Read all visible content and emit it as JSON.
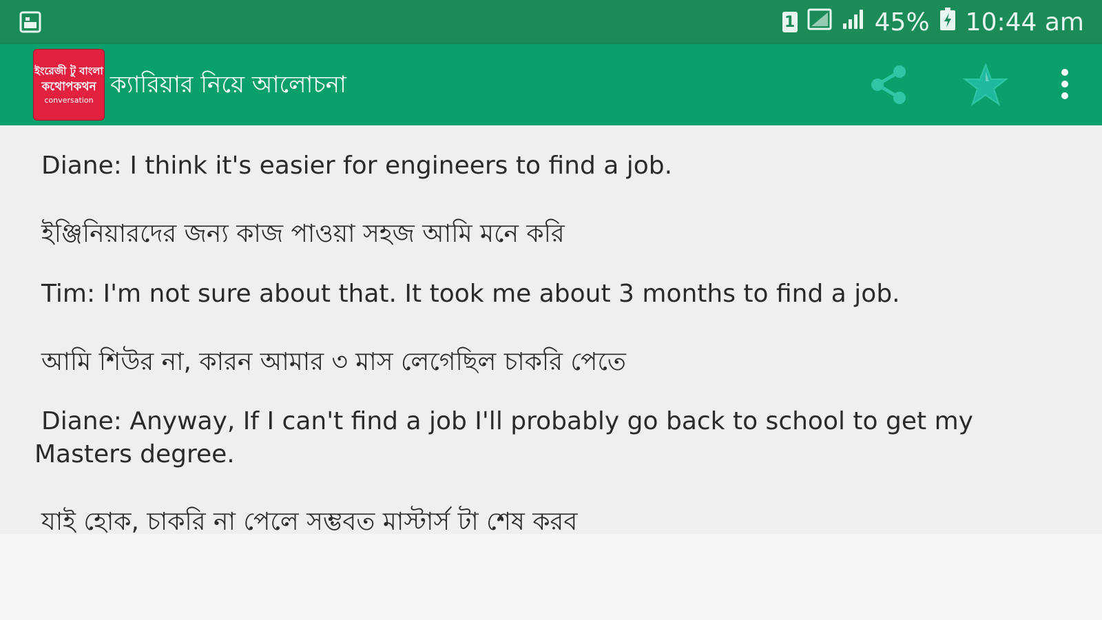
{
  "status_bar": {
    "sim_label": "1",
    "battery_percent": "45%",
    "time": "10:44 am",
    "colors": {
      "background": "#1b8b58",
      "foreground": "#e9f5ef"
    },
    "icons": [
      "image-icon",
      "sim-icon",
      "signal-box-icon",
      "signal-bars-icon",
      "battery-charging-icon"
    ]
  },
  "app_bar": {
    "title": "ক্যারিয়ার নিয়ে আলোচনা",
    "logo": {
      "line1": "ইংরেজী টু বাংলা",
      "line2": "কথোপকথন",
      "line3": "conversation",
      "color": "#e2203f"
    },
    "actions": [
      "share-icon",
      "star-icon",
      "overflow-menu-icon"
    ],
    "colors": {
      "background": "#0aa06b",
      "icon": "#2fc6a6"
    }
  },
  "content": {
    "lines": [
      "Diane: I think it's easier for engineers to find a job.",
      "ইঞ্জিনিয়ারদের জন্য কাজ পাওয়া সহজ আমি মনে করি",
      "Tim: I'm not sure about that. It took me about 3 months to find a job.",
      "আমি শিউর না, কারন আমার ৩ মাস লেগেছিল চাকরি পেতে",
      "Diane: Anyway, If I can't find a job I'll probably go back to school to get my Masters degree.",
      "যাই হোক, চাকরি না পেলে সম্ভবত মাস্টার্স টা শেষ করব"
    ]
  }
}
